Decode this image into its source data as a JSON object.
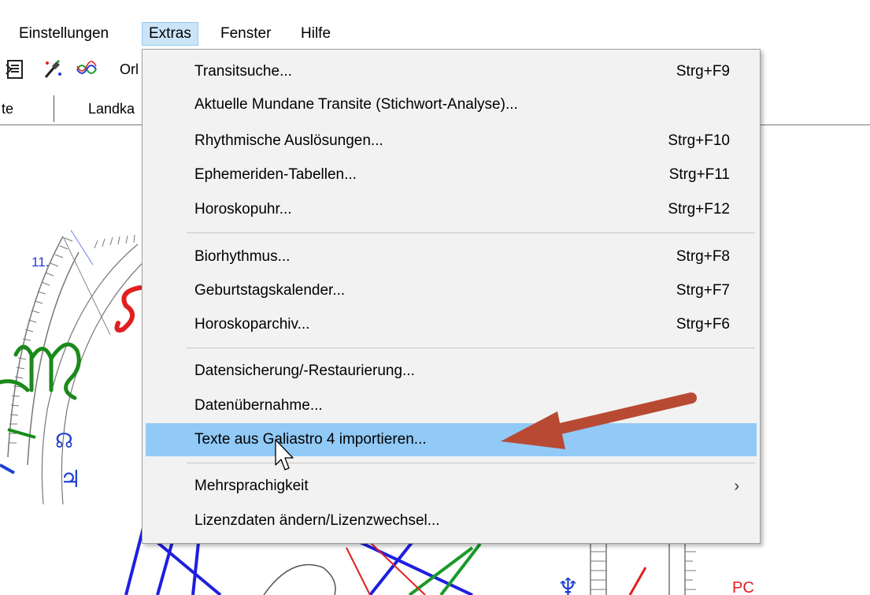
{
  "menubar": {
    "items": [
      {
        "label": "Einstellungen"
      },
      {
        "label": "Extras",
        "active": true
      },
      {
        "label": "Fenster"
      },
      {
        "label": "Hilfe"
      }
    ]
  },
  "toolbar": {
    "icons": [
      "document-icon",
      "wand-icon",
      "wave-icon"
    ],
    "partial_text": "Orl"
  },
  "tabs": [
    {
      "label": "te"
    },
    {
      "label": "Landka"
    }
  ],
  "dropdown": {
    "items": [
      {
        "label": "Transitsuche...",
        "shortcut": "Strg+F9"
      },
      {
        "label": "Aktuelle Mundane Transite (Stichwort-Analyse)...",
        "shortcut": ""
      },
      {
        "label": "Rhythmische Auslösungen...",
        "shortcut": "Strg+F10"
      },
      {
        "label": "Ephemeriden-Tabellen...",
        "shortcut": "Strg+F11"
      },
      {
        "label": "Horoskopuhr...",
        "shortcut": "Strg+F12"
      },
      {
        "label": "Biorhythmus...",
        "shortcut": "Strg+F8"
      },
      {
        "label": "Geburtstagskalender...",
        "shortcut": "Strg+F7"
      },
      {
        "label": "Horoskoparchiv...",
        "shortcut": "Strg+F6"
      },
      {
        "label": "Datensicherung/-Restaurierung...",
        "shortcut": ""
      },
      {
        "label": "Datenübernahme...",
        "shortcut": ""
      },
      {
        "label": "Texte aus Galiastro 4 importieren...",
        "shortcut": "",
        "highlighted": true
      },
      {
        "label": "Mehrsprachigkeit",
        "shortcut": "",
        "submenu_glyph": "›"
      },
      {
        "label": "Lizenzdaten ändern/Lizenzwechsel...",
        "shortcut": ""
      }
    ]
  },
  "chart_fragments": {
    "house_number": "11.",
    "pc_label": "PC"
  },
  "colors": {
    "menu_bg": "#f2f2f2",
    "highlight": "#91c9f7",
    "active_menu": "#cce4f7",
    "arrow": "#c0392b",
    "aspect_blue": "#1f1fe0",
    "aspect_red": "#e02020",
    "aspect_green": "#1a9a2a",
    "chart_green": "#1a8a1a"
  }
}
